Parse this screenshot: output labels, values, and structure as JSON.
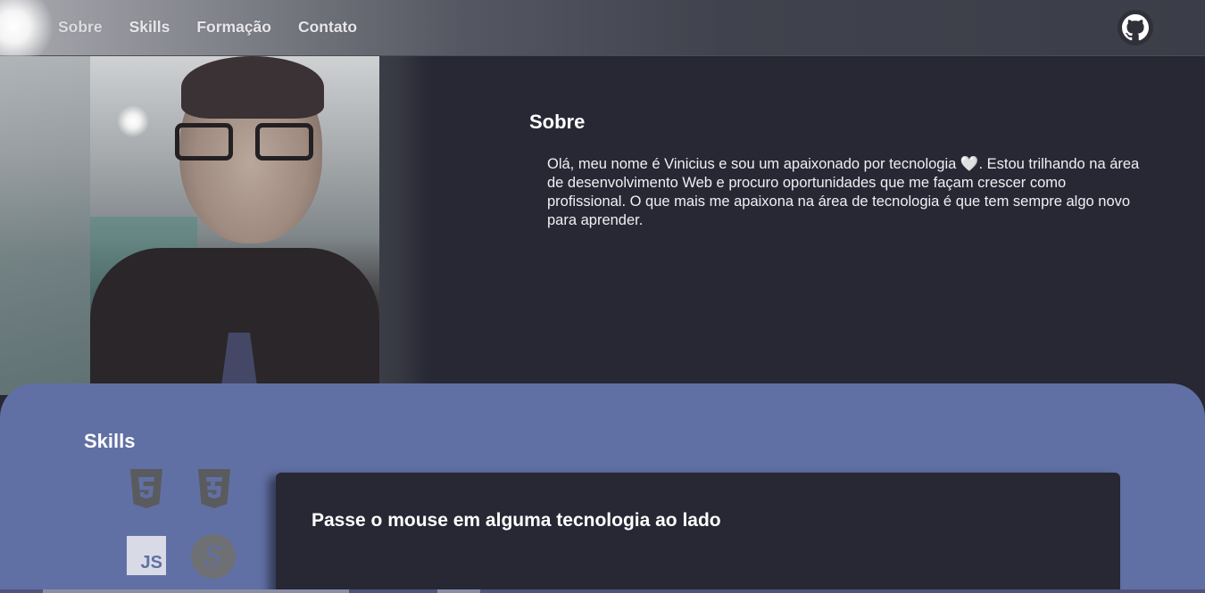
{
  "nav": {
    "items": [
      "Sobre",
      "Skills",
      "Formação",
      "Contato"
    ],
    "github_icon": "github-icon"
  },
  "profile_photo": {
    "icon": "profile-photo"
  },
  "about": {
    "title": "Sobre",
    "text": "Olá, meu nome é Vinicius e sou um apaixonado por tecnologia 🤍. Estou trilhando na área de desenvolvimento Web e procuro oportunidades que me façam crescer como profissional. O que mais me apaixona na área de tecnologia é que tem sempre algo novo para aprender."
  },
  "skills": {
    "title": "Skills",
    "technologies": [
      {
        "name": "html5-icon",
        "label": "5"
      },
      {
        "name": "css3-icon",
        "label": "3"
      },
      {
        "name": "javascript-icon",
        "label": "JS"
      },
      {
        "name": "sass-icon",
        "label": "S"
      }
    ],
    "panel_text": "Passe o mouse em alguma tecnologia ao lado"
  },
  "colors": {
    "background": "#272834",
    "skills_bg": "#6170a4",
    "header": "#3b3d48"
  }
}
